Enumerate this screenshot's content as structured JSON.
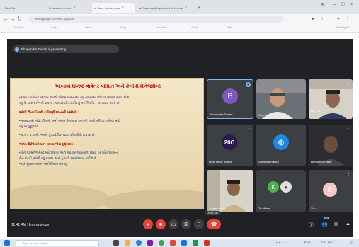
{
  "browser": {
    "tabs": [
      {
        "label": "New Tab"
      },
      {
        "label": "www.meet.com"
      },
      {
        "label": "Meet - knosyujuas"
      },
      {
        "label": "Panchayat Agriculture University"
      }
    ],
    "url": "meet.google.com/kno-syuj-uas",
    "bookmarks": [
      "YouTube",
      "Google",
      "News",
      "Maps",
      "Translate",
      "Gmail",
      "Drive"
    ],
    "reading_list": "Reading list"
  },
  "meet": {
    "presenting_label": "Bhupendra Tandel is presenting",
    "time": "11:41 AM",
    "separator": "|",
    "meeting_code": "kno-syuj-uas",
    "leave_call_tip": "Leave call",
    "tiles": [
      {
        "name": "Bhupendra Tandel",
        "initial": "B",
        "kind": "avatar",
        "color": "#7e57c2"
      },
      {
        "name": "Rasesh",
        "kind": "photo"
      },
      {
        "name": "DIP Gir",
        "kind": "photo"
      },
      {
        "name": "surat crime branch",
        "kind": "logo",
        "logo_text": "20C"
      },
      {
        "name": "Sandeep Rajgor",
        "kind": "globe"
      },
      {
        "name": "sumanbhai patel",
        "kind": "photo"
      },
      {
        "name": "Yogesh Patel",
        "kind": "photo"
      },
      {
        "name": "76 others",
        "initial": "K",
        "kind": "others",
        "color": "#4caf50"
      },
      {
        "name": "You",
        "initial": "B",
        "kind": "avatar",
        "color": "#f4c7c3"
      }
    ],
    "controls": [
      "mic-off",
      "camera-off",
      "captions",
      "present",
      "more",
      "end-call"
    ],
    "right_controls": [
      "info",
      "people",
      "chat",
      "activities"
    ],
    "people_count": "85"
  },
  "slide": {
    "title": "આંબામાં ઘનિષ્ઠ વાવેતર પદ્ધતિ અને કેનોપી મેનેજમેન્ટ",
    "lines": [
      {
        "text": "• ઘનિષ્ઠ વાવેતર પદ્ધતિ એટલે એકમ વિસ્તારમાં વધુ સંખ્યામાં છોડની રોપણી કરવી જેથી",
        "style": "normal"
      },
      {
        "text": "  વધુ ઉત્પાદન મેળવી શકાય. આ પદ્ધતિમાં છોડનું કદ નિયંત્રિત રાખવામાં આવે છે.",
        "style": "normal"
      },
      {
        "text": "ઓછી ઊંચાઈવાળી / ઠીંગણી જાતોની પસંદગી :",
        "style": "head"
      },
      {
        "text": "• આમ્રપાલી જેવી ઠીંગણી અને સતત ઉત્પાદન આપતી જાતો ઘનિષ્ઠ વાવેતર માટે",
        "style": "normal"
      },
      {
        "text": "  વધુ અનુકૂળ છે.",
        "style": "normal"
      },
      {
        "text": "• ૨.૫ x ૨.૫ મી. અંતરે હેક્ટરદીઠ ૧૬૦૦ છોડ રોપી શકાય છે.",
        "style": "normal"
      },
      {
        "text": "આંબા ઉછેરમાં ધ્યાન રાખવા જેવા મુદ્દાઓ :",
        "style": "head"
      },
      {
        "text": "• કેનોપી મેનેજમેન્ટ માટે છટણી અને આકાર આપવાની ક્રિયા દર વર્ષે નિયમિત",
        "style": "blue"
      },
      {
        "text": "  રીતે કરવી, જેથી વધુ પ્રકાશ અને હવાની અવરજવર થઈ શકે.",
        "style": "blue"
      },
      {
        "text": "  જરૂર મુજબ ખાતર અને પિયત આપવું.",
        "style": "blue"
      }
    ]
  },
  "taskbar": {
    "search_placeholder": "Type here to search",
    "lang": "ENG",
    "clock": "11:41 AM"
  }
}
